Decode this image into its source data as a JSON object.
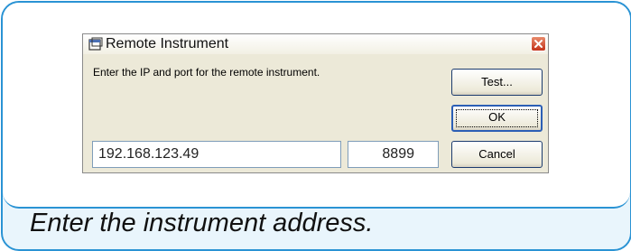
{
  "dialog": {
    "title": "Remote Instrument",
    "prompt": "Enter the IP and port for the remote instrument.",
    "ip_value": "192.168.123.49",
    "port_value": "8899",
    "buttons": {
      "test": "Test...",
      "ok": "OK",
      "cancel": "Cancel"
    }
  },
  "caption": "Enter the instrument address.",
  "icons": {
    "title": "window-icon",
    "close": "close-icon"
  },
  "colors": {
    "frame_border": "#2a93d4",
    "frame_background": "#e9f5fc",
    "dialog_background": "#ece9d8",
    "close_button": "#c4331b"
  }
}
